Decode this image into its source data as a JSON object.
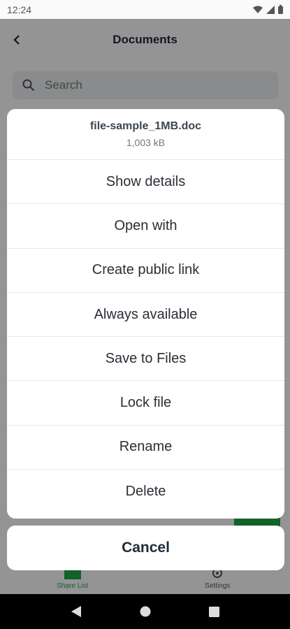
{
  "status_bar": {
    "time": "12:24"
  },
  "header": {
    "title": "Documents"
  },
  "search": {
    "placeholder": "Search"
  },
  "bottom_nav": [
    {
      "label": "Share List",
      "active": true
    },
    {
      "label": "Settings",
      "active": false
    }
  ],
  "sheet": {
    "file_name": "file-sample_1MB.doc",
    "file_size": "1,003 kB",
    "actions": [
      "Show details",
      "Open with",
      "Create public link",
      "Always available",
      "Save to Files",
      "Lock file",
      "Rename",
      "Delete"
    ],
    "cancel_label": "Cancel"
  },
  "colors": {
    "accent": "#22a84a",
    "scrim": "rgba(0,0,0,0.42)"
  },
  "icons": [
    "wifi-icon",
    "signal-icon",
    "battery-icon",
    "back-arrow-icon",
    "search-icon",
    "plus-icon",
    "gear-icon",
    "nav-back-icon",
    "nav-home-icon",
    "nav-recents-icon"
  ]
}
